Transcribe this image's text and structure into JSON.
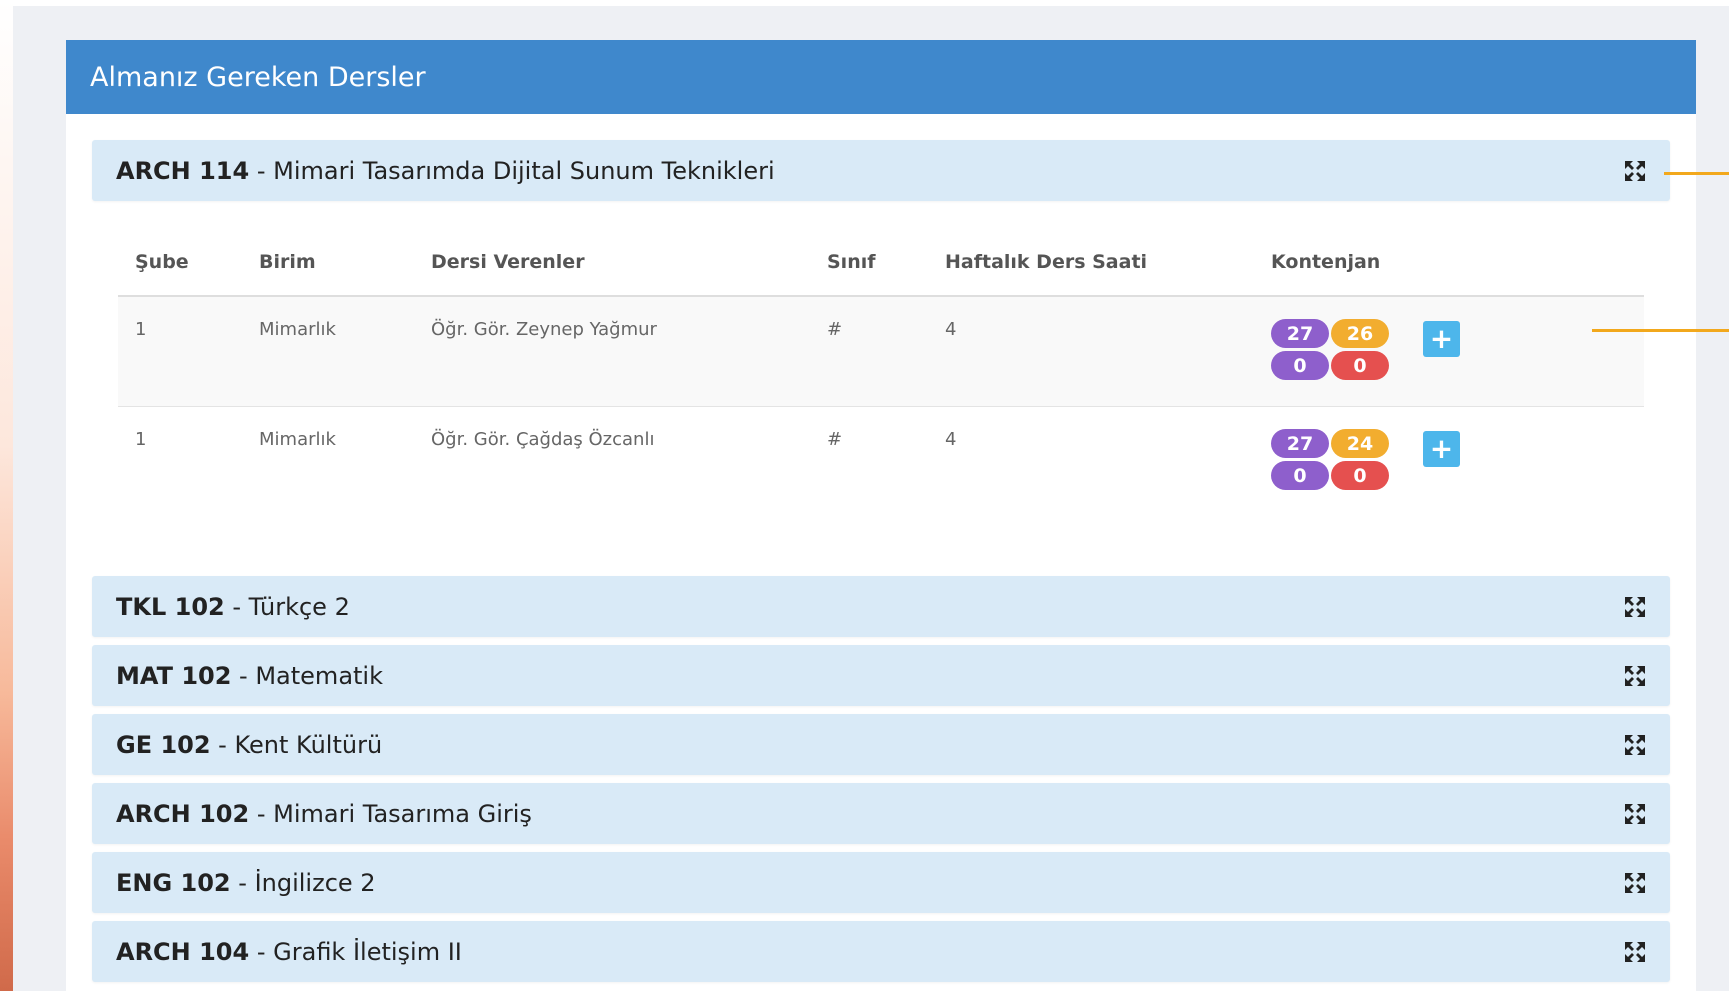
{
  "panel": {
    "title": "Almanız Gereken Dersler"
  },
  "expanded_course": {
    "code": "ARCH 114",
    "separator": " - ",
    "name": "Mimari Tasarımda Dijital Sunum Teknikleri",
    "columns": {
      "sube": "Şube",
      "birim": "Birim",
      "instructors": "Dersi Verenler",
      "sinif": "Sınıf",
      "hours": "Haftalık Ders Saati",
      "quota": "Kontenjan"
    },
    "sections": [
      {
        "sube": "1",
        "birim": "Mimarlık",
        "instructor": "Öğr. Gör. Zeynep Yağmur",
        "sinif": "#",
        "hours": "4",
        "quota": {
          "purple_top": "27",
          "orange_top": "26",
          "purple_bottom": "0",
          "red_bottom": "0"
        },
        "add_label": "+"
      },
      {
        "sube": "1",
        "birim": "Mimarlık",
        "instructor": "Öğr. Gör. Çağdaş Özcanlı",
        "sinif": "#",
        "hours": "4",
        "quota": {
          "purple_top": "27",
          "orange_top": "24",
          "purple_bottom": "0",
          "red_bottom": "0"
        },
        "add_label": "+"
      }
    ]
  },
  "courses": [
    {
      "code": "TKL 102",
      "separator": " - ",
      "name": "Türkçe 2"
    },
    {
      "code": "MAT 102",
      "separator": " - ",
      "name": "Matematik"
    },
    {
      "code": "GE 102",
      "separator": " - ",
      "name": "Kent Kültürü"
    },
    {
      "code": "ARCH 102",
      "separator": " - ",
      "name": "Mimari Tasarıma Giriş"
    },
    {
      "code": "ENG 102",
      "separator": " - ",
      "name": "İngilizce 2"
    },
    {
      "code": "ARCH 104",
      "separator": " - ",
      "name": "Grafik İletişim II"
    }
  ],
  "icons": {
    "expand": "expand-arrows-icon",
    "add": "plus-icon"
  },
  "colors": {
    "header": "#3f88cc",
    "course_bar": "#d9eaf7",
    "badge_purple": "#8e5fcc",
    "badge_orange": "#f2ad2f",
    "badge_red": "#e5504f",
    "add_button": "#4db6eb",
    "annotation_line": "#f2a81c"
  }
}
